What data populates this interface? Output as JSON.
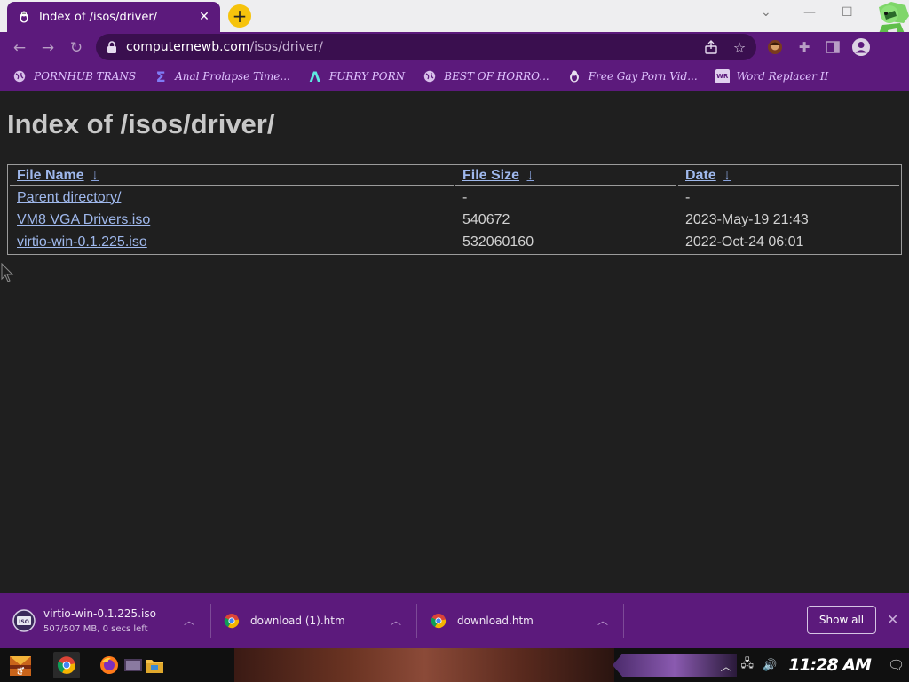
{
  "browser": {
    "tab": {
      "title": "Index of /isos/driver/",
      "favicon": "penguin-favicon-icon"
    },
    "url": {
      "host": "computernewb.com",
      "path": "/isos/driver/"
    },
    "bookmarks": [
      {
        "label": "PORNHUB TRANS",
        "icon": "globe-icon"
      },
      {
        "label": "Anal Prolapse Time...",
        "icon": "sigma-icon"
      },
      {
        "label": "FURRY PORN",
        "icon": "lambda-icon"
      },
      {
        "label": "BEST OF HORRO...",
        "icon": "globe-icon"
      },
      {
        "label": "Free Gay Porn Vid...",
        "icon": "penguin-icon"
      },
      {
        "label": "Word Replacer II",
        "icon": "wr-icon"
      }
    ]
  },
  "page": {
    "title": "Index of /isos/driver/",
    "columns": [
      {
        "label": "File Name",
        "arrow": "↓"
      },
      {
        "label": "File Size",
        "arrow": "↓"
      },
      {
        "label": "Date",
        "arrow": "↓"
      }
    ],
    "rows": [
      {
        "name": "Parent directory/",
        "size": "-",
        "date": "-"
      },
      {
        "name": "VM8 VGA Drivers.iso",
        "size": "540672",
        "date": "2023-May-19 21:43"
      },
      {
        "name": "virtio-win-0.1.225.iso",
        "size": "532060160",
        "date": "2022-Oct-24 06:01"
      }
    ]
  },
  "downloads": {
    "items": [
      {
        "name": "virtio-win-0.1.225.iso",
        "status": "507/507 MB, 0 secs left",
        "icon": "iso-disc-icon"
      },
      {
        "name": "download (1).htm",
        "status": "",
        "icon": "chrome-icon"
      },
      {
        "name": "download.htm",
        "status": "",
        "icon": "chrome-icon"
      }
    ],
    "show_all_label": "Show all"
  },
  "taskbar": {
    "clock": "11:28 AM"
  },
  "colors": {
    "chrome_theme": "#5c1a7c",
    "page_background": "#1f1f1f",
    "link": "#9fb8ec",
    "heading": "#c8c8c8"
  }
}
